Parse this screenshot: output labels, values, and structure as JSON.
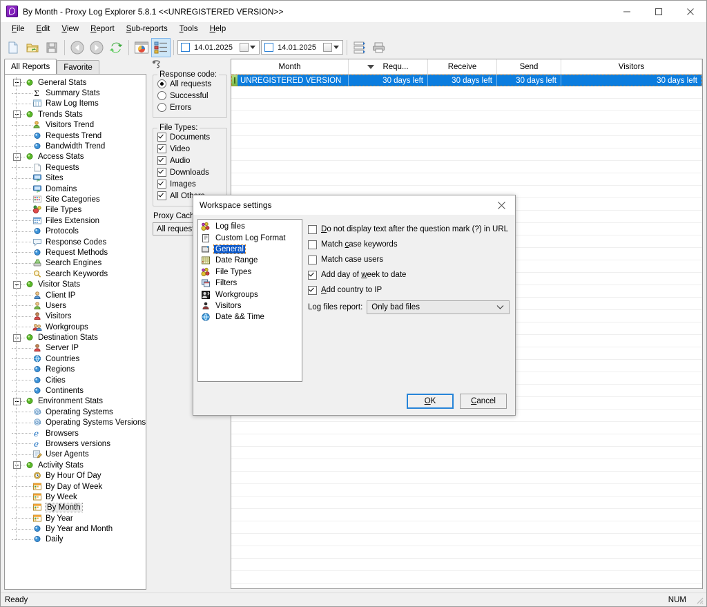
{
  "window": {
    "title": "By Month - Proxy Log Explorer 5.8.1 <<UNREGISTERED VERSION>>",
    "app_icon": "proxy-log-explorer-icon",
    "minimize": "minimize-icon",
    "maximize": "maximize-icon",
    "close": "close-icon"
  },
  "menu": [
    {
      "label": "File",
      "accel": "F"
    },
    {
      "label": "Edit",
      "accel": "E"
    },
    {
      "label": "View",
      "accel": "V"
    },
    {
      "label": "Report",
      "accel": "R"
    },
    {
      "label": "Sub-reports",
      "accel": "S"
    },
    {
      "label": "Tools",
      "accel": "T"
    },
    {
      "label": "Help",
      "accel": "H"
    }
  ],
  "toolbar": {
    "buttons": [
      {
        "name": "new-document-icon"
      },
      {
        "name": "open-folder-icon"
      },
      {
        "name": "save-icon"
      },
      {
        "name": "back-arrow-icon"
      },
      {
        "name": "forward-arrow-icon"
      },
      {
        "name": "refresh-icon"
      },
      {
        "name": "chart-icon"
      },
      {
        "name": "list-view-icon",
        "selected": true
      },
      {
        "name": "grid-icon"
      },
      {
        "name": "print-icon"
      }
    ],
    "date_from": "14.01.2025",
    "date_to": "14.01.2025"
  },
  "sidebar": {
    "tabs": [
      {
        "label": "All Reports",
        "active": true
      },
      {
        "label": "Favorite",
        "active": false
      }
    ],
    "tree": [
      {
        "label": "General Stats",
        "level": 0,
        "icon": "green-dot-icon",
        "expander": true
      },
      {
        "label": "Summary Stats",
        "level": 1,
        "icon": "sigma-icon"
      },
      {
        "label": "Raw Log Items",
        "level": 1,
        "icon": "table-icon"
      },
      {
        "label": "Trends Stats",
        "level": 0,
        "icon": "green-dot-icon",
        "expander": true
      },
      {
        "label": "Visitors Trend",
        "level": 1,
        "icon": "visitors-icon"
      },
      {
        "label": "Requests Trend",
        "level": 1,
        "icon": "blue-dot-icon"
      },
      {
        "label": "Bandwidth Trend",
        "level": 1,
        "icon": "blue-dot-icon"
      },
      {
        "label": "Access Stats",
        "level": 0,
        "icon": "green-dot-icon",
        "expander": true
      },
      {
        "label": "Requests",
        "level": 1,
        "icon": "page-icon"
      },
      {
        "label": "Sites",
        "level": 1,
        "icon": "monitor-icon"
      },
      {
        "label": "Domains",
        "level": 1,
        "icon": "monitor-icon"
      },
      {
        "label": "Site Categories",
        "level": 1,
        "icon": "grid-color-icon"
      },
      {
        "label": "File Types",
        "level": 1,
        "icon": "filetypes-icon"
      },
      {
        "label": "Files Extension",
        "level": 1,
        "icon": "extension-icon"
      },
      {
        "label": "Protocols",
        "level": 1,
        "icon": "blue-dot-icon"
      },
      {
        "label": "Response Codes",
        "level": 1,
        "icon": "speech-bubble-icon"
      },
      {
        "label": "Request Methods",
        "level": 1,
        "icon": "blue-dot-icon"
      },
      {
        "label": "Search Engines",
        "level": 1,
        "icon": "search-engine-icon"
      },
      {
        "label": "Search Keywords",
        "level": 1,
        "icon": "magnifier-icon"
      },
      {
        "label": "Visitor Stats",
        "level": 0,
        "icon": "green-dot-icon",
        "expander": true
      },
      {
        "label": "Client IP",
        "level": 1,
        "icon": "user-blue-icon"
      },
      {
        "label": "Users",
        "level": 1,
        "icon": "user-green-icon"
      },
      {
        "label": "Visitors",
        "level": 1,
        "icon": "user-red-icon"
      },
      {
        "label": "Workgroups",
        "level": 1,
        "icon": "users-group-icon"
      },
      {
        "label": "Destination Stats",
        "level": 0,
        "icon": "green-dot-icon",
        "expander": true
      },
      {
        "label": "Server IP",
        "level": 1,
        "icon": "user-red-icon"
      },
      {
        "label": "Countries",
        "level": 1,
        "icon": "globe-icon"
      },
      {
        "label": "Regions",
        "level": 1,
        "icon": "blue-dot-icon"
      },
      {
        "label": "Cities",
        "level": 1,
        "icon": "blue-dot-icon"
      },
      {
        "label": "Continents",
        "level": 1,
        "icon": "blue-dot-icon"
      },
      {
        "label": "Environment Stats",
        "level": 0,
        "icon": "green-dot-icon",
        "expander": true
      },
      {
        "label": "Operating Systems",
        "level": 1,
        "icon": "os-icon"
      },
      {
        "label": "Operating Systems Versions",
        "level": 1,
        "icon": "os-icon"
      },
      {
        "label": "Browsers",
        "level": 1,
        "icon": "browser-icon"
      },
      {
        "label": "Browsers versions",
        "level": 1,
        "icon": "browser-icon"
      },
      {
        "label": "User Agents",
        "level": 1,
        "icon": "useragent-icon"
      },
      {
        "label": "Activity Stats",
        "level": 0,
        "icon": "green-dot-icon",
        "expander": true
      },
      {
        "label": "By Hour Of Day",
        "level": 1,
        "icon": "clock-icon"
      },
      {
        "label": "By Day of Week",
        "level": 1,
        "icon": "calendar-icon"
      },
      {
        "label": "By Week",
        "level": 1,
        "icon": "calendar-icon"
      },
      {
        "label": "By Month",
        "level": 1,
        "icon": "calendar-icon",
        "selected": true
      },
      {
        "label": "By Year",
        "level": 1,
        "icon": "calendar-icon"
      },
      {
        "label": "By Year and Month",
        "level": 1,
        "icon": "blue-dot-icon"
      },
      {
        "label": "Daily",
        "level": 1,
        "icon": "blue-dot-icon"
      }
    ]
  },
  "filters": {
    "header_icon": "filter-icon",
    "response_code": {
      "caption": "Response code:",
      "options": [
        {
          "label": "All requests",
          "checked": true
        },
        {
          "label": "Successful",
          "checked": false
        },
        {
          "label": "Errors",
          "checked": false
        }
      ]
    },
    "file_types": {
      "caption": "File Types:",
      "options": [
        {
          "label": "Documents",
          "checked": true
        },
        {
          "label": "Video",
          "checked": true
        },
        {
          "label": "Audio",
          "checked": true
        },
        {
          "label": "Downloads",
          "checked": true
        },
        {
          "label": "Images",
          "checked": true
        },
        {
          "label": "All Others",
          "checked": true
        }
      ]
    },
    "proxy_caching_label": "Proxy Caching:",
    "proxy_caching_value": "All requests"
  },
  "table": {
    "columns": [
      {
        "label": "Month",
        "width": 170,
        "align": "center"
      },
      {
        "label": "Requ...",
        "width": 115,
        "align": "center",
        "sorted": true,
        "sort_dir": "desc"
      },
      {
        "label": "Receive",
        "width": 100,
        "align": "center"
      },
      {
        "label": "Send",
        "width": 93,
        "align": "center"
      },
      {
        "label": "Visitors",
        "width": 97,
        "align": "center"
      }
    ],
    "rows": [
      {
        "marker": "green-marker",
        "selected": true,
        "cells": [
          "UNREGISTERED VERSION",
          "30 days left",
          "30 days left",
          "30 days left",
          "30 days left"
        ]
      }
    ]
  },
  "dialog": {
    "title": "Workspace settings",
    "close_icon": "close-icon",
    "list": [
      {
        "label": "Log files",
        "icon": "log-files-icon"
      },
      {
        "label": "Custom Log Format",
        "icon": "custom-format-icon"
      },
      {
        "label": "General",
        "icon": "general-icon",
        "selected": true
      },
      {
        "label": "Date Range",
        "icon": "date-range-icon"
      },
      {
        "label": "File Types",
        "icon": "file-types-icon"
      },
      {
        "label": "Filters",
        "icon": "filters-icon"
      },
      {
        "label": "Workgroups",
        "icon": "workgroups-icon"
      },
      {
        "label": "Visitors",
        "icon": "visitors-icon"
      },
      {
        "label": "Date && Time",
        "icon": "date-time-icon"
      }
    ],
    "options": [
      {
        "label": "Do not display text after the question mark (?) in URL",
        "checked": false,
        "accel_index": 0
      },
      {
        "label": "Match case keywords",
        "checked": false,
        "accel_index": 6
      },
      {
        "label": "Match case users",
        "checked": false,
        "accel_index": -1
      },
      {
        "label": "Add day of week to date",
        "checked": true,
        "accel_index": 11
      },
      {
        "label": "Add country to IP",
        "checked": true,
        "accel_index": 0
      }
    ],
    "log_files_report_label": "Log files report:",
    "log_files_report_value": "Only bad files",
    "ok_label": "OK",
    "cancel_label": "Cancel"
  },
  "statusbar": {
    "message": "Ready",
    "num": "NUM"
  }
}
